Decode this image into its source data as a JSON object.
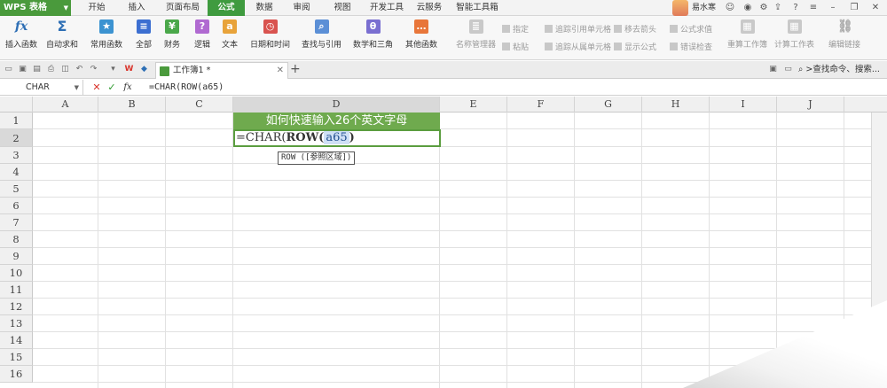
{
  "app": {
    "title": "WPS 表格"
  },
  "menu_tabs": [
    "开始",
    "插入",
    "页面布局",
    "公式",
    "数据",
    "审阅",
    "视图",
    "开发工具",
    "云服务",
    "智能工具箱"
  ],
  "active_tab": "公式",
  "user": {
    "name": "易水寒"
  },
  "ribbon": {
    "insert_function": "插入函数",
    "autosum": "自动求和",
    "common_functions": "常用函数",
    "all": "全部",
    "financial": "财务",
    "logical": "逻辑",
    "text": "文本",
    "datetime": "日期和时间",
    "lookup": "查找与引用",
    "math": "数学和三角",
    "other": "其他函数",
    "name_manager": "名称管理器",
    "specify": "指定",
    "paste": "粘贴",
    "trace_precedents": "追踪引用单元格",
    "trace_dependents": "追踪从属单元格",
    "remove_arrows": "移去箭头",
    "show_formulas": "显示公式",
    "evaluate_formula": "公式求值",
    "error_checking": "错误检查",
    "recalc_workbook": "重算工作簿",
    "calc_sheet": "计算工作表",
    "edit_links": "编辑链接"
  },
  "doc_tab": {
    "name": "工作簿1 *"
  },
  "search": {
    "label": "查找命令、搜索..."
  },
  "formula_bar": {
    "name_box": "CHAR",
    "fx": "fx",
    "formula": "=CHAR(ROW(a65)"
  },
  "columns": [
    "A",
    "B",
    "C",
    "D",
    "E",
    "F",
    "G",
    "H",
    "I",
    "J"
  ],
  "rows": [
    "1",
    "2",
    "3",
    "4",
    "5",
    "6",
    "7",
    "8",
    "9",
    "10",
    "11",
    "12",
    "13",
    "14",
    "15",
    "16"
  ],
  "cells": {
    "D1": "如何快速输入26个英文字母",
    "D2_prefix": "=CHAR(",
    "D2_fn": "ROW",
    "D2_open": "(",
    "D2_arg": "a65",
    "D2_close": ")"
  },
  "tooltip": "ROW ([参照区域])",
  "colors": {
    "accent": "#3f9b3f",
    "title_cell": "#6faa4e"
  }
}
